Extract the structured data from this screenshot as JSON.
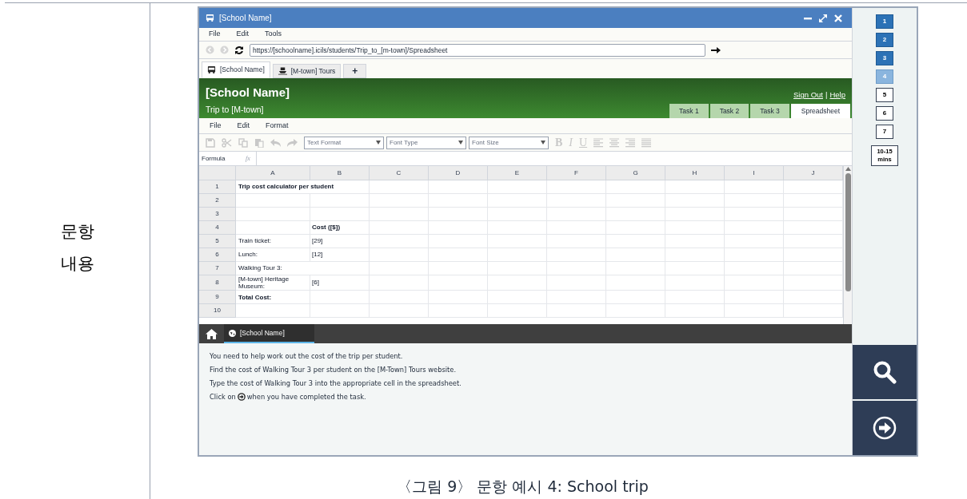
{
  "row_label": "문항 내용",
  "window": {
    "title": "[School Name]"
  },
  "browser_menu": [
    "File",
    "Edit",
    "Tools"
  ],
  "address": {
    "value": "https://[schoolname].icils/students/Trip_to_[m-town]/Spreadsheet"
  },
  "browser_tabs": [
    {
      "label": "[School Name]",
      "kind": "bus",
      "selected": true
    },
    {
      "label": "[M-town] Tours",
      "kind": "boat",
      "selected": false
    },
    {
      "label": "+",
      "kind": "plus",
      "selected": false
    }
  ],
  "site": {
    "title": "[School Name]",
    "subtitle": "Trip to [M-town]",
    "links": [
      "Sign Out",
      "Help"
    ],
    "link_separator": "|"
  },
  "task_tabs": [
    {
      "label": "Task 1",
      "selected": false
    },
    {
      "label": "Task 2",
      "selected": false
    },
    {
      "label": "Task 3",
      "selected": false
    },
    {
      "label": "Spreadsheet",
      "selected": true
    }
  ],
  "sheet_menu": [
    "File",
    "Edit",
    "Format"
  ],
  "dropdowns": [
    {
      "placeholder": "Text Format"
    },
    {
      "placeholder": "Font Type"
    },
    {
      "placeholder": "Font Size"
    }
  ],
  "format_buttons": [
    "B",
    "I",
    "U"
  ],
  "formula_label": "Formula",
  "formula_icon": "fx",
  "table": {
    "columns": [
      "A",
      "B",
      "C",
      "D",
      "E",
      "F",
      "G",
      "H",
      "I",
      "J"
    ],
    "rows": [
      {
        "number": "1",
        "a": "Trip cost calculator per student",
        "bold": true
      },
      {
        "number": "2"
      },
      {
        "number": "3"
      },
      {
        "number": "4",
        "b": "Cost ([$])",
        "bold": true
      },
      {
        "number": "5",
        "a": "Train ticket:",
        "b": "[29]"
      },
      {
        "number": "6",
        "a": "Lunch:",
        "b": "[12]"
      },
      {
        "number": "7",
        "a": "Walking Tour 3:"
      },
      {
        "number": "8",
        "a": "[M-town] Heritage Museum:",
        "b": "[6]"
      },
      {
        "number": "9",
        "a": "Total Cost:",
        "bold": true
      },
      {
        "number": "10"
      }
    ]
  },
  "bottom_tab": {
    "label": "[School Name]",
    "selected": true
  },
  "instructions": [
    {
      "kind": "text",
      "text": "You need to help work out the cost of the trip per student."
    },
    {
      "kind": "text",
      "text": "Find the cost of Walking Tour 3 per student on the [M-Town] Tours website."
    },
    {
      "kind": "text",
      "text": "Type the cost of Walking Tour 3 into the appropriate cell in the spreadsheet."
    },
    {
      "kind": "icon_text",
      "before": "Click on",
      "after": "when you have completed the task."
    }
  ],
  "progress": [
    {
      "label": "1",
      "completed": true,
      "selected": false
    },
    {
      "label": "2",
      "completed": true,
      "selected": false
    },
    {
      "label": "3",
      "completed": true,
      "selected": false
    },
    {
      "label": "4",
      "completed": false,
      "selected": true
    },
    {
      "label": "5",
      "completed": false,
      "selected": false
    },
    {
      "label": "6",
      "completed": false,
      "selected": false
    },
    {
      "label": "7",
      "completed": false,
      "selected": false
    }
  ],
  "time": "10-15 mins",
  "caption": "〈그림 9〉 문항 예시 4: School trip"
}
